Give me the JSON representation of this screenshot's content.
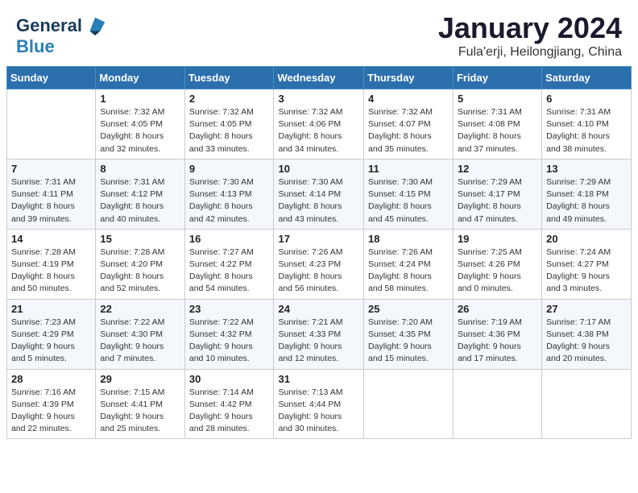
{
  "header": {
    "logo_line1": "General",
    "logo_line2": "Blue",
    "title": "January 2024",
    "subtitle": "Fula'erji, Heilongjiang, China"
  },
  "days_of_week": [
    "Sunday",
    "Monday",
    "Tuesday",
    "Wednesday",
    "Thursday",
    "Friday",
    "Saturday"
  ],
  "weeks": [
    [
      {
        "day": "",
        "info": ""
      },
      {
        "day": "1",
        "info": "Sunrise: 7:32 AM\nSunset: 4:05 PM\nDaylight: 8 hours\nand 32 minutes."
      },
      {
        "day": "2",
        "info": "Sunrise: 7:32 AM\nSunset: 4:05 PM\nDaylight: 8 hours\nand 33 minutes."
      },
      {
        "day": "3",
        "info": "Sunrise: 7:32 AM\nSunset: 4:06 PM\nDaylight: 8 hours\nand 34 minutes."
      },
      {
        "day": "4",
        "info": "Sunrise: 7:32 AM\nSunset: 4:07 PM\nDaylight: 8 hours\nand 35 minutes."
      },
      {
        "day": "5",
        "info": "Sunrise: 7:31 AM\nSunset: 4:08 PM\nDaylight: 8 hours\nand 37 minutes."
      },
      {
        "day": "6",
        "info": "Sunrise: 7:31 AM\nSunset: 4:10 PM\nDaylight: 8 hours\nand 38 minutes."
      }
    ],
    [
      {
        "day": "7",
        "info": "Sunrise: 7:31 AM\nSunset: 4:11 PM\nDaylight: 8 hours\nand 39 minutes."
      },
      {
        "day": "8",
        "info": "Sunrise: 7:31 AM\nSunset: 4:12 PM\nDaylight: 8 hours\nand 40 minutes."
      },
      {
        "day": "9",
        "info": "Sunrise: 7:30 AM\nSunset: 4:13 PM\nDaylight: 8 hours\nand 42 minutes."
      },
      {
        "day": "10",
        "info": "Sunrise: 7:30 AM\nSunset: 4:14 PM\nDaylight: 8 hours\nand 43 minutes."
      },
      {
        "day": "11",
        "info": "Sunrise: 7:30 AM\nSunset: 4:15 PM\nDaylight: 8 hours\nand 45 minutes."
      },
      {
        "day": "12",
        "info": "Sunrise: 7:29 AM\nSunset: 4:17 PM\nDaylight: 8 hours\nand 47 minutes."
      },
      {
        "day": "13",
        "info": "Sunrise: 7:29 AM\nSunset: 4:18 PM\nDaylight: 8 hours\nand 49 minutes."
      }
    ],
    [
      {
        "day": "14",
        "info": "Sunrise: 7:28 AM\nSunset: 4:19 PM\nDaylight: 8 hours\nand 50 minutes."
      },
      {
        "day": "15",
        "info": "Sunrise: 7:28 AM\nSunset: 4:20 PM\nDaylight: 8 hours\nand 52 minutes."
      },
      {
        "day": "16",
        "info": "Sunrise: 7:27 AM\nSunset: 4:22 PM\nDaylight: 8 hours\nand 54 minutes."
      },
      {
        "day": "17",
        "info": "Sunrise: 7:26 AM\nSunset: 4:23 PM\nDaylight: 8 hours\nand 56 minutes."
      },
      {
        "day": "18",
        "info": "Sunrise: 7:26 AM\nSunset: 4:24 PM\nDaylight: 8 hours\nand 58 minutes."
      },
      {
        "day": "19",
        "info": "Sunrise: 7:25 AM\nSunset: 4:26 PM\nDaylight: 9 hours\nand 0 minutes."
      },
      {
        "day": "20",
        "info": "Sunrise: 7:24 AM\nSunset: 4:27 PM\nDaylight: 9 hours\nand 3 minutes."
      }
    ],
    [
      {
        "day": "21",
        "info": "Sunrise: 7:23 AM\nSunset: 4:29 PM\nDaylight: 9 hours\nand 5 minutes."
      },
      {
        "day": "22",
        "info": "Sunrise: 7:22 AM\nSunset: 4:30 PM\nDaylight: 9 hours\nand 7 minutes."
      },
      {
        "day": "23",
        "info": "Sunrise: 7:22 AM\nSunset: 4:32 PM\nDaylight: 9 hours\nand 10 minutes."
      },
      {
        "day": "24",
        "info": "Sunrise: 7:21 AM\nSunset: 4:33 PM\nDaylight: 9 hours\nand 12 minutes."
      },
      {
        "day": "25",
        "info": "Sunrise: 7:20 AM\nSunset: 4:35 PM\nDaylight: 9 hours\nand 15 minutes."
      },
      {
        "day": "26",
        "info": "Sunrise: 7:19 AM\nSunset: 4:36 PM\nDaylight: 9 hours\nand 17 minutes."
      },
      {
        "day": "27",
        "info": "Sunrise: 7:17 AM\nSunset: 4:38 PM\nDaylight: 9 hours\nand 20 minutes."
      }
    ],
    [
      {
        "day": "28",
        "info": "Sunrise: 7:16 AM\nSunset: 4:39 PM\nDaylight: 9 hours\nand 22 minutes."
      },
      {
        "day": "29",
        "info": "Sunrise: 7:15 AM\nSunset: 4:41 PM\nDaylight: 9 hours\nand 25 minutes."
      },
      {
        "day": "30",
        "info": "Sunrise: 7:14 AM\nSunset: 4:42 PM\nDaylight: 9 hours\nand 28 minutes."
      },
      {
        "day": "31",
        "info": "Sunrise: 7:13 AM\nSunset: 4:44 PM\nDaylight: 9 hours\nand 30 minutes."
      },
      {
        "day": "",
        "info": ""
      },
      {
        "day": "",
        "info": ""
      },
      {
        "day": "",
        "info": ""
      }
    ]
  ]
}
